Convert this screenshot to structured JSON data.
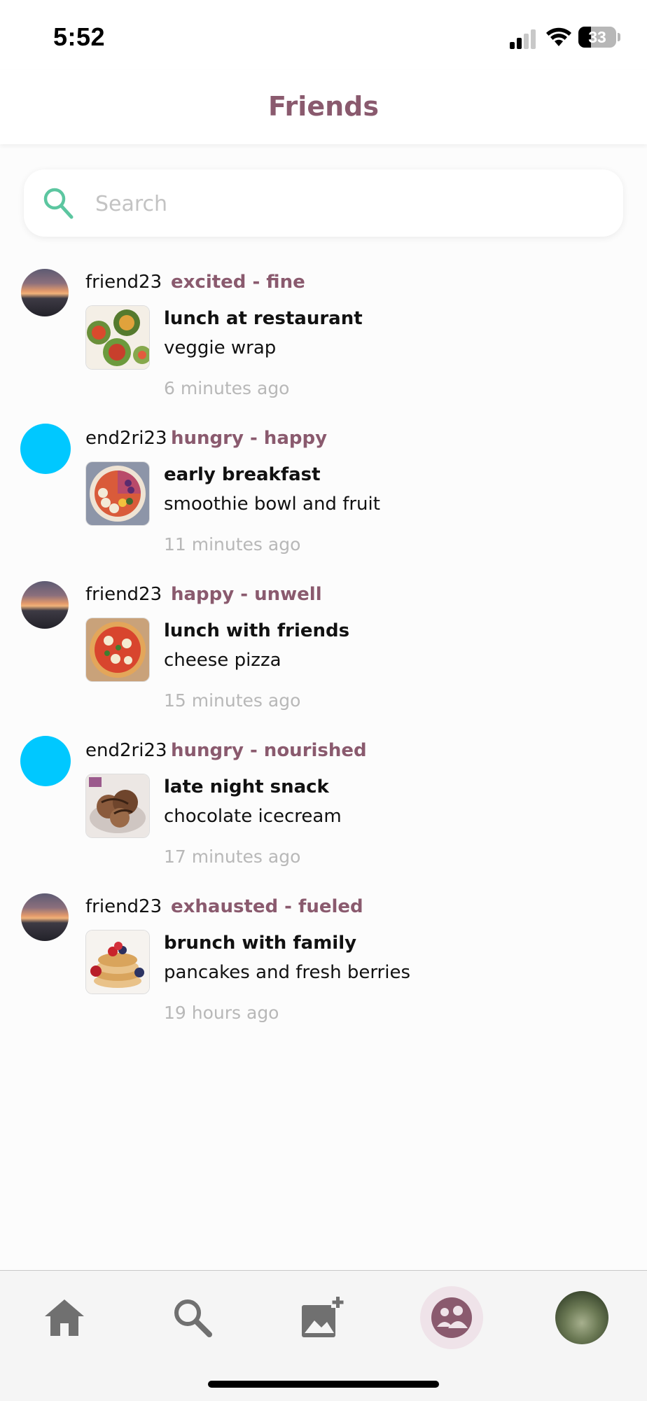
{
  "status_bar": {
    "time": "5:52",
    "battery": "33"
  },
  "header": {
    "title": "Friends"
  },
  "search": {
    "placeholder": "Search",
    "value": ""
  },
  "feed": [
    {
      "username": "friend23",
      "mood": "excited - fine",
      "meal_title": "lunch at restaurant",
      "meal_desc": "veggie wrap",
      "time_ago": "6 minutes ago",
      "avatar": "sunset-photo",
      "thumb": "veggie-wrap-photo"
    },
    {
      "username": "end2ri23",
      "mood": "hungry - happy",
      "meal_title": "early breakfast",
      "meal_desc": "smoothie bowl and fruit",
      "time_ago": "11 minutes ago",
      "avatar": "blue-circle",
      "thumb": "smoothie-bowl-photo"
    },
    {
      "username": "friend23",
      "mood": "happy - unwell",
      "meal_title": "lunch with friends",
      "meal_desc": "cheese pizza",
      "time_ago": "15 minutes ago",
      "avatar": "sunset-photo",
      "thumb": "pizza-photo"
    },
    {
      "username": "end2ri23",
      "mood": "hungry - nourished",
      "meal_title": "late night snack",
      "meal_desc": "chocolate icecream",
      "time_ago": "17 minutes ago",
      "avatar": "blue-circle",
      "thumb": "icecream-photo"
    },
    {
      "username": "friend23",
      "mood": "exhausted - fueled",
      "meal_title": "brunch with family",
      "meal_desc": "pancakes and fresh berries",
      "time_ago": "19 hours ago",
      "avatar": "sunset-photo",
      "thumb": "pancakes-photo"
    }
  ],
  "bottom_nav": [
    {
      "icon": "home-icon",
      "active": false
    },
    {
      "icon": "search-icon",
      "active": false
    },
    {
      "icon": "add-photo-icon",
      "active": false
    },
    {
      "icon": "friends-icon",
      "active": true
    },
    {
      "icon": "profile-avatar",
      "active": false
    }
  ],
  "colors": {
    "accent": "#8a5a6e",
    "search_icon": "#5cc6a0",
    "avatar_blue": "#00c8ff",
    "muted_text": "#b8b8b8",
    "active_nav_bg": "#efe3e9"
  }
}
